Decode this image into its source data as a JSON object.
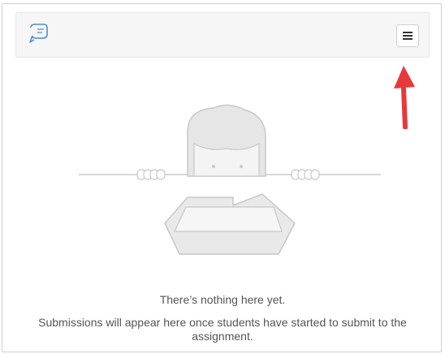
{
  "toolbar": {
    "logo_icon": "pencil-stylus-logo-icon",
    "menu_icon": "hamburger-menu-icon"
  },
  "annotation": {
    "arrow_icon": "red-arrow-icon",
    "color": "#e8383b"
  },
  "empty_state": {
    "illustration_icon": "peeking-character-with-empty-tray-icon",
    "title": "There’s nothing here yet.",
    "description": "Submissions will appear here once students have started to submit to the assignment."
  },
  "colors": {
    "illustration_fill": "#e6e6e6",
    "illustration_stroke": "#c8c8c8",
    "text": "#555555"
  }
}
